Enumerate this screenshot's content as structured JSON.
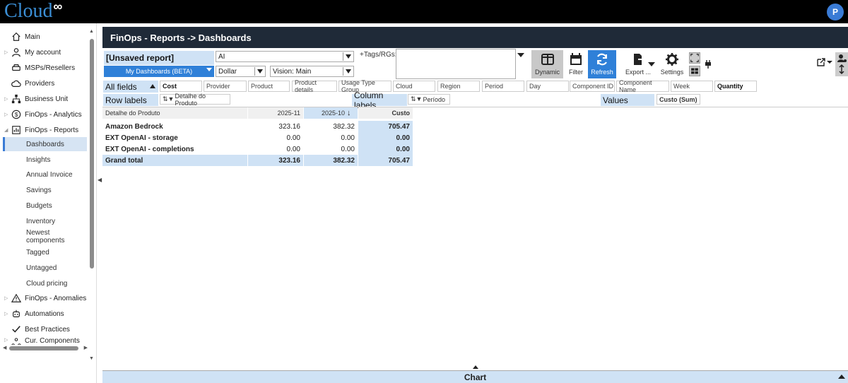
{
  "brand": {
    "logo_text": "Cloud",
    "logo_symbol": "∞",
    "user_initial": "P"
  },
  "sidebar": {
    "items": [
      {
        "label": "Main",
        "icon": "home-icon"
      },
      {
        "label": "My account",
        "icon": "user-icon"
      },
      {
        "label": "MSPs/Resellers",
        "icon": "car-icon"
      },
      {
        "label": "Providers",
        "icon": "cloud-icon"
      },
      {
        "label": "Business Unit",
        "icon": "sitemap-icon"
      },
      {
        "label": "FinOps - Analytics",
        "icon": "dollar-icon"
      },
      {
        "label": "FinOps - Reports",
        "icon": "report-icon"
      }
    ],
    "subitems": [
      {
        "label": "Dashboards",
        "active": true
      },
      {
        "label": "Insights"
      },
      {
        "label": "Annual Invoice"
      },
      {
        "label": "Savings"
      },
      {
        "label": "Budgets"
      },
      {
        "label": "Inventory"
      },
      {
        "label": "Newest components"
      },
      {
        "label": "Tagged"
      },
      {
        "label": "Untagged"
      },
      {
        "label": "Cloud pricing"
      }
    ],
    "items_after": [
      {
        "label": "FinOps - Anomalies",
        "icon": "warning-icon"
      },
      {
        "label": "Automations",
        "icon": "robot-icon"
      },
      {
        "label": "Best Practices",
        "icon": "check-icon"
      },
      {
        "label": "Cur. Components",
        "icon": "components-icon"
      }
    ]
  },
  "header": {
    "title": "FinOps - Reports -> Dashboards"
  },
  "report": {
    "unsaved_label": "[Unsaved report]",
    "dashboards_select": "My Dashboards (BETA)",
    "ai_select": "AI",
    "currency_select": "Dollar",
    "vision_select": "Vision: Main",
    "tags_label": "+Tags/RGs:"
  },
  "toolbar": {
    "dynamic": "Dynamic",
    "filter": "Filter",
    "refresh": "Refresh",
    "export": "Export ...",
    "settings": "Settings"
  },
  "fields": {
    "all_fields_label": "All fields",
    "list": [
      "Cost",
      "Provider",
      "Product",
      "Product details",
      "Usage Type Group",
      "Cloud",
      "Region",
      "Period",
      "Day",
      "Component ID",
      "Component Name",
      "Week",
      "Quantity"
    ]
  },
  "labels": {
    "row_labels": "Row labels",
    "row_field": "Detalhe do Produto",
    "column_labels": "Column labels",
    "column_field": "Período",
    "values": "Values",
    "values_field": "Custo (Sum)"
  },
  "pivot": {
    "row_header": "Detalhe do Produto",
    "columns": [
      "2025-11",
      "2025-10",
      "Custo"
    ],
    "rows": [
      {
        "name": "Amazon Bedrock",
        "v1": "323.16",
        "v2": "382.32",
        "total": "705.47"
      },
      {
        "name": "EXT OpenAI - storage",
        "v1": "0.00",
        "v2": "0.00",
        "total": "0.00"
      },
      {
        "name": "EXT OpenAI - completions",
        "v1": "0.00",
        "v2": "0.00",
        "total": "0.00"
      }
    ],
    "grand_total": {
      "name": "Grand total",
      "v1": "323.16",
      "v2": "382.32",
      "total": "705.47"
    }
  },
  "chart_panel": {
    "label": "Chart"
  }
}
